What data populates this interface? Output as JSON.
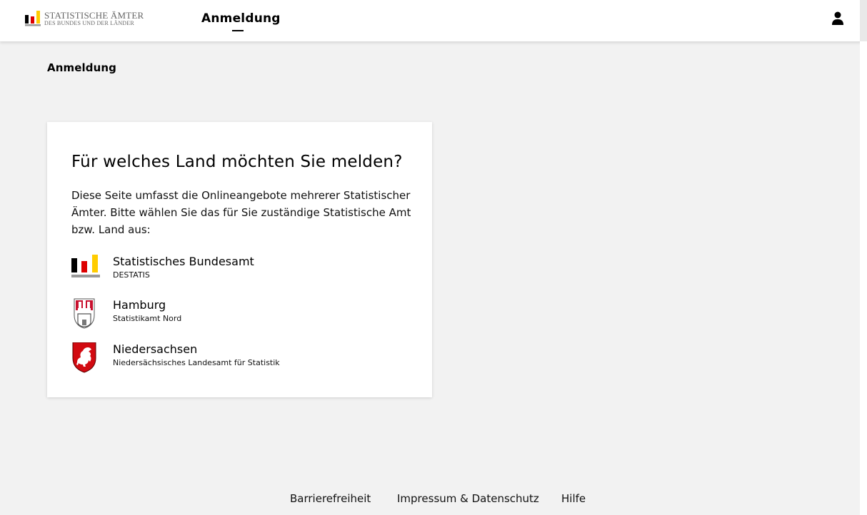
{
  "header": {
    "logo_line1": "STATISTISCHE ÄMTER",
    "logo_line2": "DES BUNDES UND DER LÄNDER",
    "nav_tab": "Anmeldung",
    "user_icon": "user-icon"
  },
  "page": {
    "heading": "Anmeldung"
  },
  "card": {
    "title": "Für welches Land möchten Sie melden?",
    "description": "Diese Seite umfasst die Onlineangebote mehrerer Statistischer Ämter. Bitte wählen Sie das für Sie zuständige Statistische Amt bzw. Land aus:",
    "options": [
      {
        "name": "Statistisches Bundesamt",
        "sub": "DESTATIS",
        "icon": "destatis-logo-icon"
      },
      {
        "name": "Hamburg",
        "sub": "Statistikamt Nord",
        "icon": "hamburg-coat-of-arms-icon"
      },
      {
        "name": "Niedersachsen",
        "sub": "Niedersächsisches Landesamt für Statistik",
        "icon": "niedersachsen-horse-icon"
      }
    ]
  },
  "footer": {
    "links": [
      "Barrierefreiheit",
      "Impressum & Datenschutz",
      "Hilfe"
    ]
  },
  "colors": {
    "background": "#f2f2f2",
    "card": "#ffffff",
    "flag_black": "#000000",
    "flag_red": "#dd0000",
    "flag_gold": "#ffcc00",
    "hamburg_red": "#c8102e",
    "niedersachsen_red": "#d20a11"
  }
}
